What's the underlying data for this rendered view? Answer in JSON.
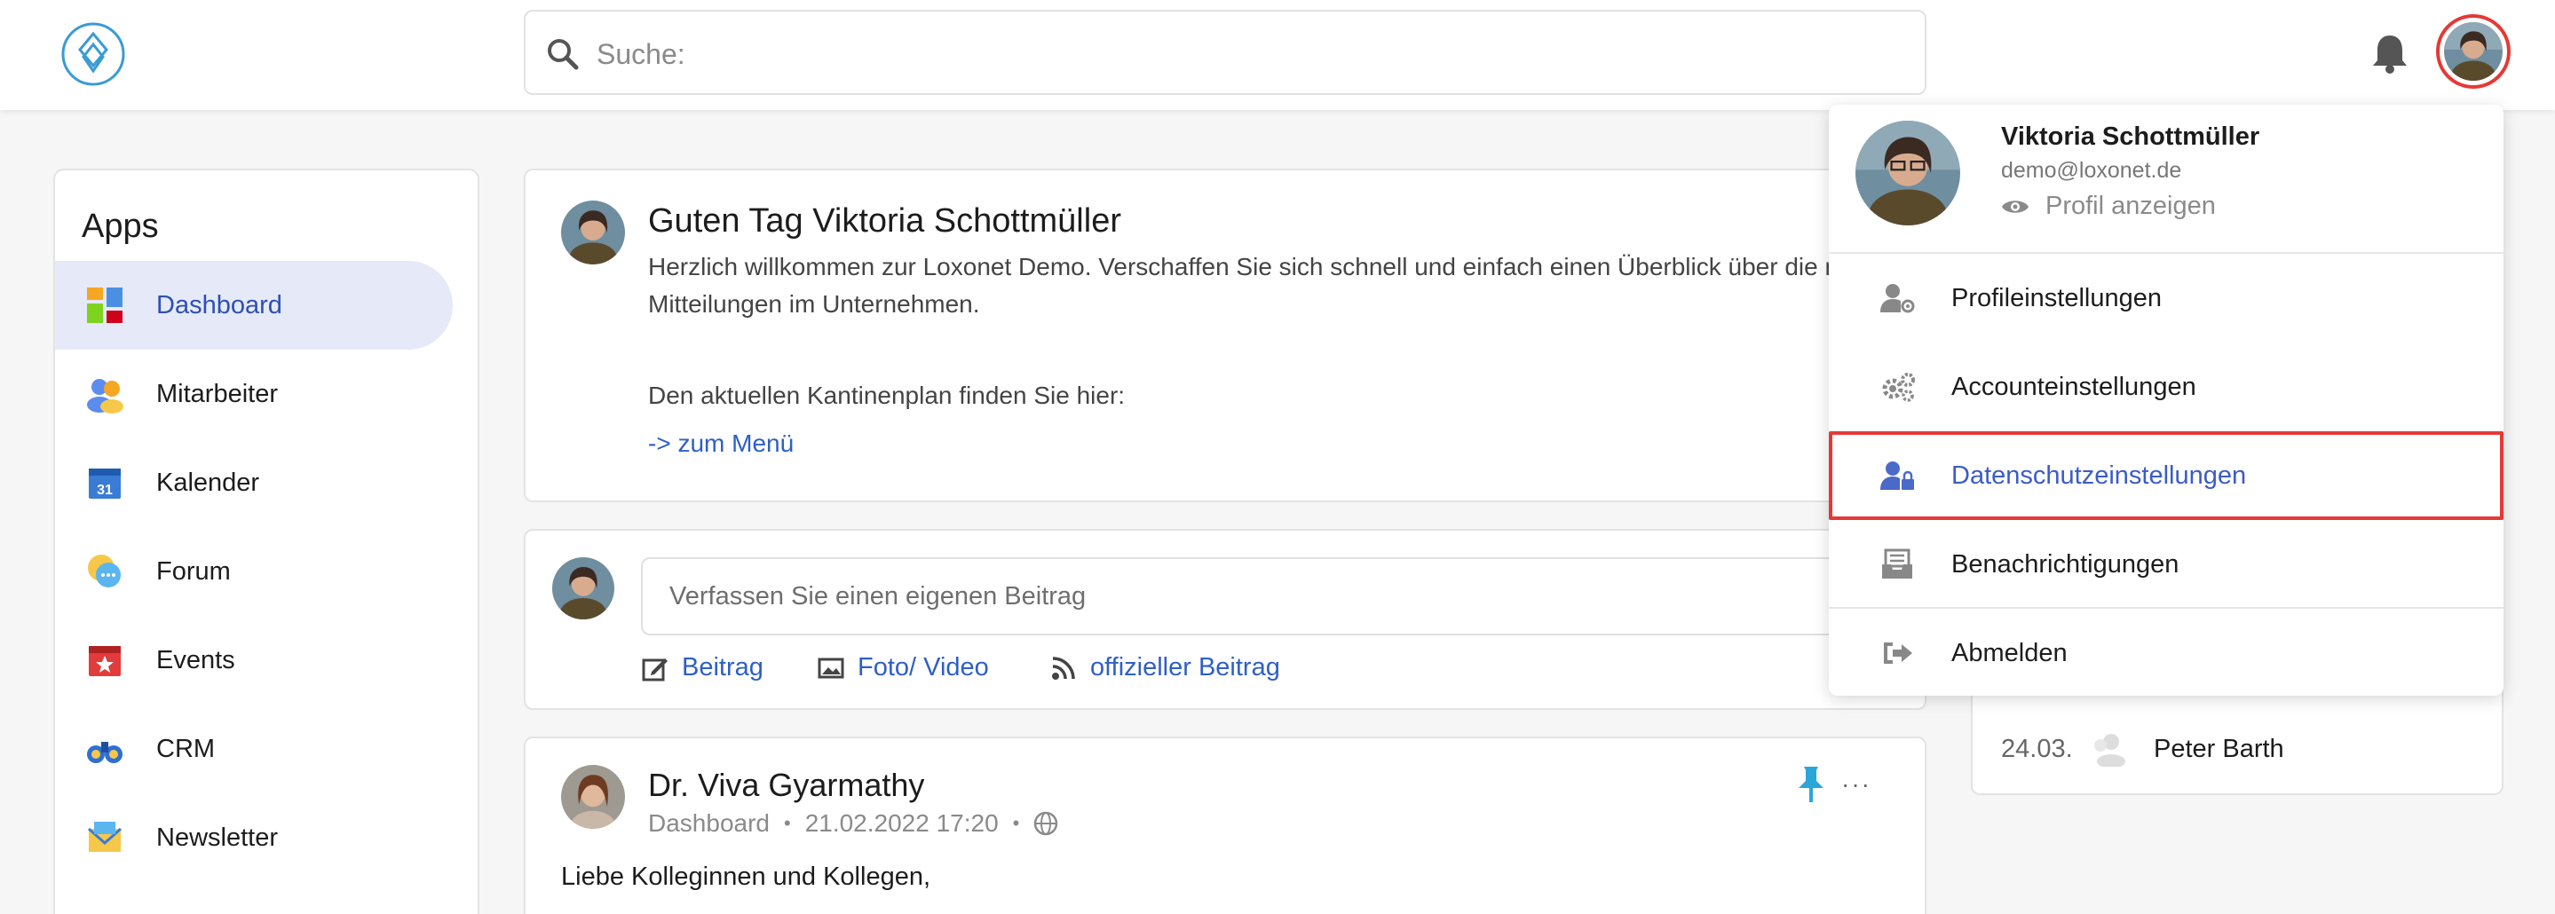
{
  "header": {
    "search_placeholder": "Suche:"
  },
  "sidebar": {
    "title": "Apps",
    "items": [
      {
        "label": "Dashboard",
        "icon": "dashboard-icon",
        "active": true
      },
      {
        "label": "Mitarbeiter",
        "icon": "people-icon"
      },
      {
        "label": "Kalender",
        "icon": "calendar-icon",
        "icon_text": "31"
      },
      {
        "label": "Forum",
        "icon": "chat-bubble-icon"
      },
      {
        "label": "Events",
        "icon": "event-star-icon"
      },
      {
        "label": "CRM",
        "icon": "binoculars-icon"
      },
      {
        "label": "Newsletter",
        "icon": "envelope-icon"
      }
    ]
  },
  "greeting": {
    "title": "Guten Tag Viktoria Schottmüller",
    "text": "Herzlich willkommen zur Loxonet Demo. Verschaffen Sie sich schnell und einfach einen Überblick über die neusten Mitteilungen im Unternehmen.",
    "text2": "Den aktuellen Kantinenplan finden Sie hier:",
    "link": "-> zum Menü"
  },
  "compose": {
    "placeholder": "Verfassen Sie einen eigenen Beitrag",
    "actions": [
      "Beitrag",
      "Foto/ Video",
      "offizieller Beitrag"
    ]
  },
  "post": {
    "author": "Dr. Viva Gyarmathy",
    "channel": "Dashboard",
    "datetime": "21.02.2022 17:20",
    "body": "Liebe Kolleginnen und Kollegen,",
    "more": "···"
  },
  "birthdays": {
    "date": "24.03.",
    "name": "Peter Barth"
  },
  "user_menu": {
    "name": "Viktoria Schottmüller",
    "email": "demo@loxonet.de",
    "view_profile": "Profil anzeigen",
    "items": [
      {
        "label": "Profileinstellungen",
        "icon": "user-gear-icon"
      },
      {
        "label": "Accounteinstellungen",
        "icon": "gears-icon"
      },
      {
        "label": "Datenschutzeinstellungen",
        "icon": "user-lock-icon",
        "highlighted": true
      },
      {
        "label": "Benachrichtigungen",
        "icon": "notification-tray-icon"
      },
      {
        "label": "Abmelden",
        "icon": "sign-out-icon"
      }
    ]
  },
  "colors": {
    "accent": "#2e5fc4",
    "highlight_border": "#e53935",
    "active_nav_bg": "#e6eaf8"
  }
}
